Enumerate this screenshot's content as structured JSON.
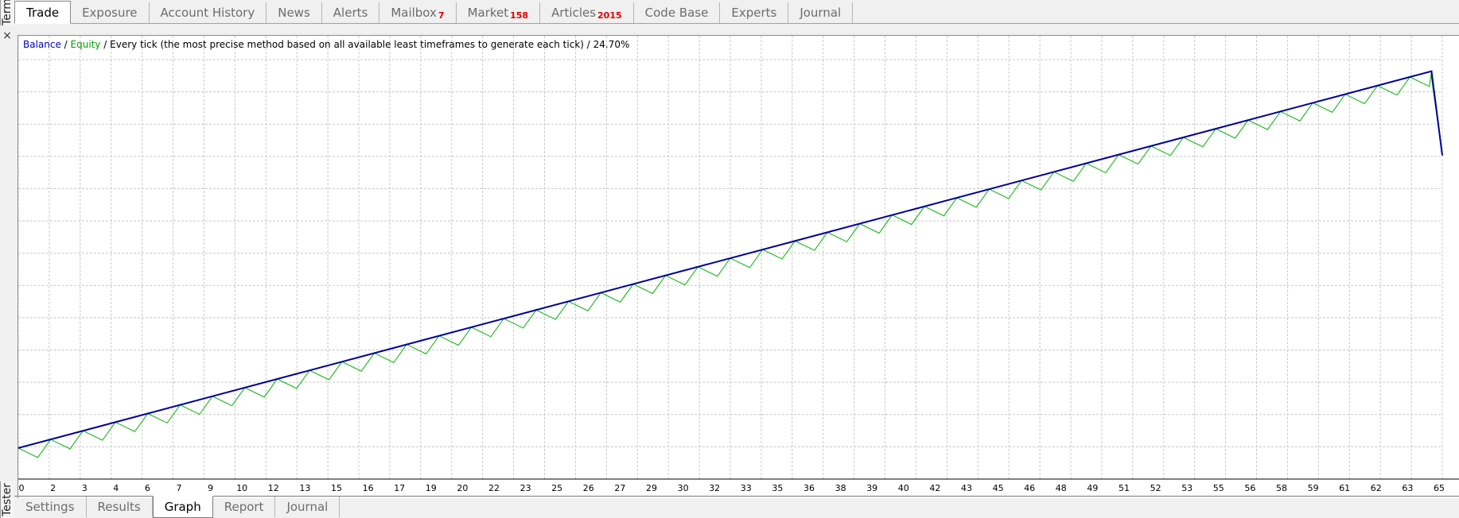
{
  "side": {
    "top_label": "Terminal",
    "bottom_label": "Tester",
    "close": "×"
  },
  "top_tabs": [
    {
      "label": "Trade",
      "badge": ""
    },
    {
      "label": "Exposure",
      "badge": ""
    },
    {
      "label": "Account History",
      "badge": ""
    },
    {
      "label": "News",
      "badge": ""
    },
    {
      "label": "Alerts",
      "badge": ""
    },
    {
      "label": "Mailbox",
      "badge": "7"
    },
    {
      "label": "Market",
      "badge": "158"
    },
    {
      "label": "Articles",
      "badge": "2015"
    },
    {
      "label": "Code Base",
      "badge": ""
    },
    {
      "label": "Experts",
      "badge": ""
    },
    {
      "label": "Journal",
      "badge": ""
    }
  ],
  "bottom_tabs": [
    {
      "label": "Settings"
    },
    {
      "label": "Results"
    },
    {
      "label": "Graph"
    },
    {
      "label": "Report"
    },
    {
      "label": "Journal"
    }
  ],
  "legend": {
    "balance": "Balance",
    "sep1": " / ",
    "equity": "Equity",
    "rest": " / Every tick (the most precise method based on all available least timeframes to generate each tick) / 24.70%"
  },
  "colors": {
    "balance": "#000099",
    "equity": "#00b400",
    "grid": "#c8c8c8"
  },
  "chart_data": {
    "type": "line",
    "x_tick_labels": [
      "0",
      "2",
      "3",
      "4",
      "6",
      "7",
      "9",
      "10",
      "12",
      "13",
      "15",
      "16",
      "17",
      "19",
      "20",
      "22",
      "23",
      "25",
      "26",
      "27",
      "29",
      "30",
      "32",
      "33",
      "35",
      "36",
      "38",
      "39",
      "40",
      "42",
      "43",
      "45",
      "46",
      "48",
      "49",
      "51",
      "52",
      "53",
      "55",
      "56",
      "58",
      "59",
      "61",
      "62",
      "63",
      "65"
    ],
    "x_range": [
      0,
      66
    ],
    "y_range": [
      0,
      100
    ],
    "y_tick_labels_shown": false,
    "grid": true,
    "series": [
      {
        "name": "Balance",
        "color": "#000099",
        "x": [
          0,
          65.5,
          66
        ],
        "y": [
          7,
          92,
          73
        ]
      },
      {
        "name": "Equity",
        "color": "#00b400",
        "sawtooth": true,
        "cycle_x": [
          0.0,
          1.5,
          3.0,
          4.5,
          6.0,
          7.5,
          9.0,
          10.5,
          12.0,
          13.5,
          15.0,
          16.5,
          18.0,
          19.5,
          21.0,
          22.5,
          24.0,
          25.5,
          27.0,
          28.5,
          30.0,
          31.5,
          33.0,
          34.5,
          36.0,
          37.5,
          39.0,
          40.5,
          42.0,
          43.5,
          45.0,
          46.5,
          48.0,
          49.5,
          51.0,
          52.5,
          54.0,
          55.5,
          57.0,
          58.5,
          60.0,
          61.5,
          63.0,
          64.5
        ],
        "dip_depth": 3.3
      }
    ]
  }
}
